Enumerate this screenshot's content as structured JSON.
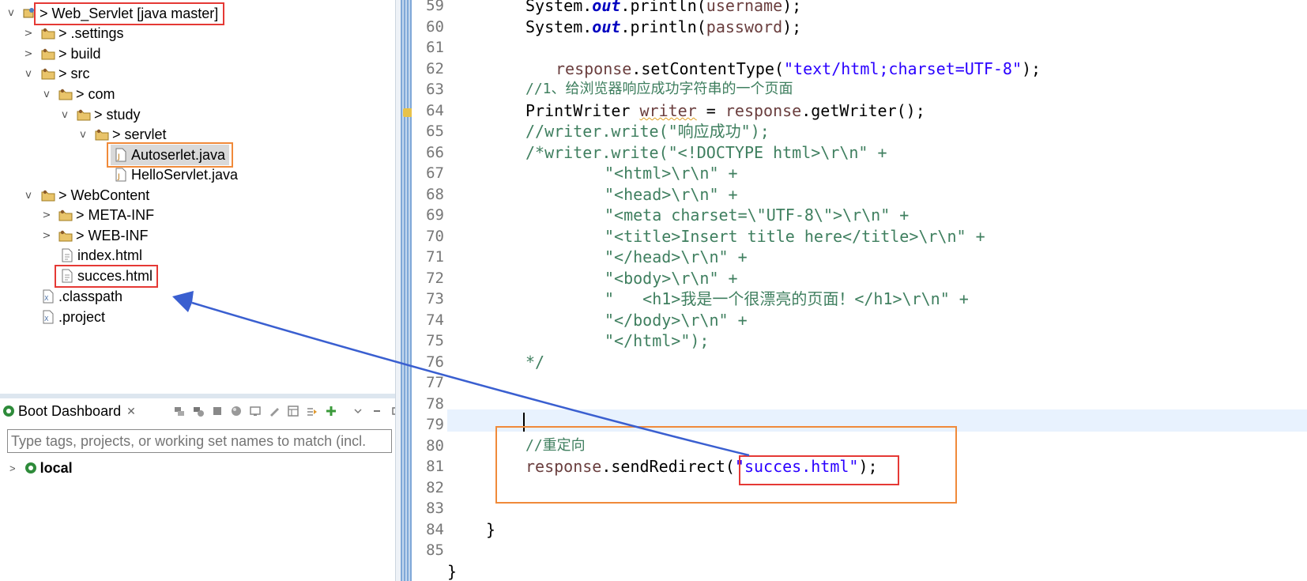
{
  "explorer": {
    "items": [
      {
        "label": "> Web_Servlet [java master]",
        "chevron": "v",
        "icon": "project-icon"
      },
      {
        "label": "> .settings",
        "chevron": ">",
        "icon": "folder-icon"
      },
      {
        "label": "> build",
        "chevron": ">",
        "icon": "folder-icon"
      },
      {
        "label": "> src",
        "chevron": "v",
        "icon": "source-folder-icon"
      },
      {
        "label": "> com",
        "chevron": "v",
        "icon": "package-icon"
      },
      {
        "label": "> study",
        "chevron": "v",
        "icon": "package-icon"
      },
      {
        "label": "> servlet",
        "chevron": "v",
        "icon": "package-icon"
      },
      {
        "label": "Autoserlet.java",
        "chevron": "",
        "icon": "java-file-icon"
      },
      {
        "label": "HelloServlet.java",
        "chevron": "",
        "icon": "java-file-icon"
      },
      {
        "label": "> WebContent",
        "chevron": "v",
        "icon": "folder-icon"
      },
      {
        "label": "> META-INF",
        "chevron": ">",
        "icon": "folder-icon"
      },
      {
        "label": "> WEB-INF",
        "chevron": ">",
        "icon": "folder-icon"
      },
      {
        "label": "index.html",
        "chevron": "",
        "icon": "html-file-icon"
      },
      {
        "label": "succes.html",
        "chevron": "",
        "icon": "html-file-icon"
      },
      {
        "label": ".classpath",
        "chevron": "",
        "icon": "xml-file-icon"
      },
      {
        "label": ".project",
        "chevron": "",
        "icon": "xml-file-icon"
      }
    ]
  },
  "dashboard": {
    "title": "Boot Dashboard",
    "close_glyph": "✕",
    "filter_placeholder": "Type tags, projects, or working set names to match (incl.",
    "local_label": "local",
    "toolbar_icons": [
      "start-icon",
      "debug-icon",
      "stop-icon",
      "refresh-icon",
      "console-icon",
      "edit-icon",
      "table-icon",
      "link-icon",
      "add-icon",
      "view-menu-icon",
      "minimize-icon",
      "maximize-icon"
    ]
  },
  "editor": {
    "line_numbers": [
      "59",
      "60",
      "61",
      "62",
      "63",
      "64",
      "65",
      "66",
      "67",
      "68",
      "69",
      "70",
      "71",
      "72",
      "73",
      "74",
      "75",
      "76",
      "77",
      "78",
      "79",
      "80",
      "81",
      "82",
      "83",
      "84",
      "85"
    ],
    "lines": {
      "l59_a": "System.",
      "l59_b": "out",
      "l59_c": ".println(",
      "l59_d": "username",
      "l59_e": ");",
      "l60_a": "System.",
      "l60_b": "out",
      "l60_c": ".println(",
      "l60_d": "password",
      "l60_e": ");",
      "l62_a": "response",
      "l62_b": ".setContentType(",
      "l62_c": "\"text/html;charset=UTF-8\"",
      "l62_d": ");",
      "l63": "//1、给浏览器响应成功字符串的一个页面",
      "l64_a": "PrintWriter ",
      "l64_b": "writer",
      "l64_c": " = ",
      "l64_d": "response",
      "l64_e": ".getWriter();",
      "l65": "//writer.write(\"响应成功\");",
      "l66": "/*writer.write(\"<!DOCTYPE html>\\r\\n\" +",
      "l67": "\"<html>\\r\\n\" +",
      "l68": "\"<head>\\r\\n\" +",
      "l69": "\"<meta charset=\\\"UTF-8\\\">\\r\\n\" +",
      "l70": "\"<title>Insert title here</title>\\r\\n\" +",
      "l71": "\"</head>\\r\\n\" +",
      "l72": "\"<body>\\r\\n\" +",
      "l73": "\"   <h1>我是一个很漂亮的页面！</h1>\\r\\n\" +",
      "l74": "\"</body>\\r\\n\" +",
      "l75": "\"</html>\");",
      "l76": "*/",
      "l79": "//重定向",
      "l80_a": "response",
      "l80_b": ".sendRedirect(",
      "l80_c": "\"succes.html\"",
      "l80_d": ");",
      "l83": "}",
      "l85": "}"
    }
  },
  "colors": {
    "highlight_red": "#e53935",
    "highlight_orange": "#f08a3a",
    "arrow_blue": "#3a5fd0",
    "string": "#2a00ff",
    "comment": "#3f7f5f",
    "static_field": "#0000c0",
    "local_var": "#6a3e3e"
  }
}
